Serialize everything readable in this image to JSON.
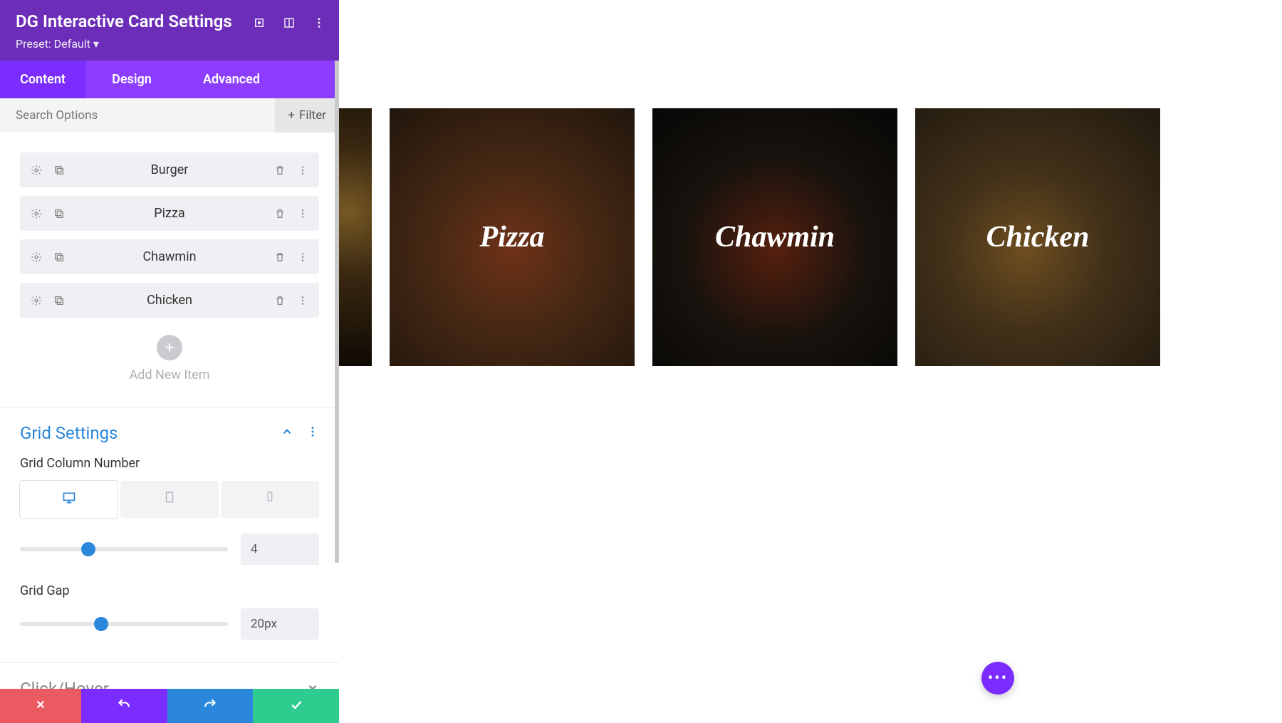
{
  "header": {
    "title": "DG Interactive Card Settings",
    "preset_label": "Preset: Default"
  },
  "tabs": {
    "content": "Content",
    "design": "Design",
    "advanced": "Advanced"
  },
  "search": {
    "placeholder": "Search Options",
    "filter_label": "Filter"
  },
  "items": [
    {
      "label": "Burger"
    },
    {
      "label": "Pizza"
    },
    {
      "label": "Chawmin"
    },
    {
      "label": "Chicken"
    }
  ],
  "add_new": {
    "label": "Add New Item"
  },
  "grid_section": {
    "title": "Grid Settings",
    "column_label": "Grid Column Number",
    "column_value": "4",
    "gap_label": "Grid Gap",
    "gap_value": "20px"
  },
  "click_hover_section": {
    "title": "Click/Hover"
  },
  "cards": [
    {
      "title": ""
    },
    {
      "title": "Pizza"
    },
    {
      "title": "Chawmin"
    },
    {
      "title": "Chicken"
    }
  ],
  "colors": {
    "purple_dark": "#6c2eb9",
    "purple": "#7b2cff",
    "purple_light": "#8d3dff",
    "blue": "#2b87da",
    "green": "#2ecc8f",
    "red": "#eb5a60"
  }
}
